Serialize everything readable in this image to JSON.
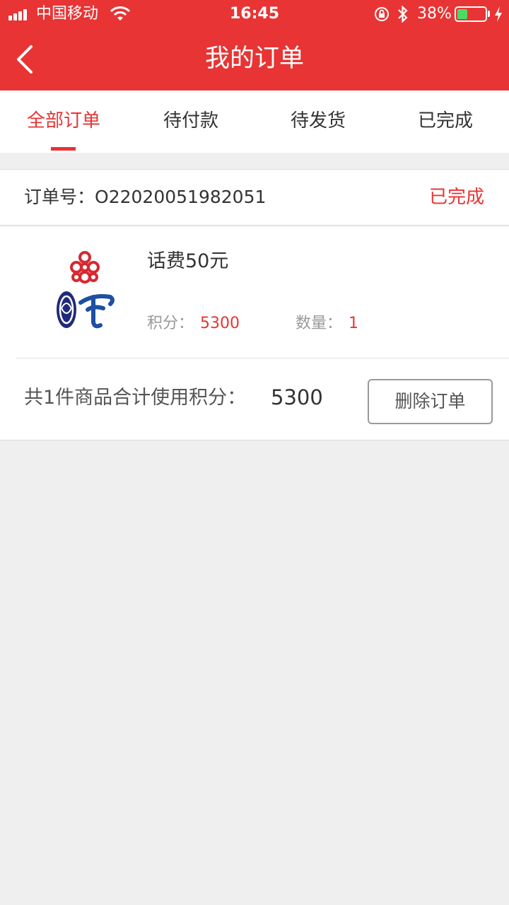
{
  "status_bar": {
    "carrier": "中国移动",
    "time": "16:45",
    "battery_percent": "38%",
    "battery_level": 0.38
  },
  "nav": {
    "title": "我的订单",
    "back_icon": "chevron-left-icon"
  },
  "tabs": [
    {
      "label": "全部订单",
      "active": true
    },
    {
      "label": "待付款",
      "active": false
    },
    {
      "label": "待发货",
      "active": false
    },
    {
      "label": "已完成",
      "active": false
    }
  ],
  "order": {
    "number_label": "订单号：",
    "number": "O22020051982051",
    "status": "已完成",
    "product": {
      "name": "话费50元",
      "points_label": "积分：",
      "points": "5300",
      "qty_label": "数量：",
      "qty": "1",
      "image_icon": "telecom-operators-logo-icon"
    },
    "summary_text": "共1件商品合计使用积分：",
    "summary_value": "5300",
    "delete_label": "删除订单"
  },
  "colors": {
    "accent": "#e83434",
    "background": "#efefef",
    "battery_green": "#4cd964"
  }
}
